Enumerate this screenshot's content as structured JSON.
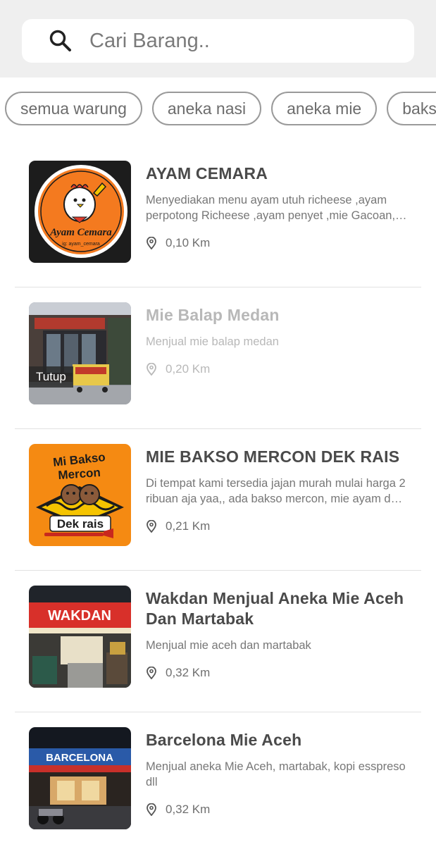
{
  "search": {
    "placeholder": "Cari Barang.."
  },
  "categories": [
    "semua warung",
    "aneka nasi",
    "aneka mie",
    "bakso"
  ],
  "stores": [
    {
      "name": "AYAM CEMARA",
      "description": "Menyediakan menu ayam utuh richeese ,ayam perpotong Richeese ,ayam penyet ,mie Gacoan, dll",
      "distance": "0,10 Km",
      "logo_text": "Ayam Cemara",
      "logo_subtext": "ig: ayam_cemara"
    },
    {
      "name": "Mie Balap Medan",
      "description": "Menjual mie balap medan",
      "distance": "0,20 Km",
      "status": "Tutup"
    },
    {
      "name": "MIE BAKSO MERCON DEK RAIS",
      "description": "Di tempat kami tersedia jajan murah mulai harga 2 ribuan aja yaa,, ada bakso mercon, mie ayam dan lainnya",
      "distance": "0,21 Km",
      "logo_text_top": "Mi Bakso",
      "logo_text_mid": "Mercon",
      "logo_text_bottom": "Dek rais"
    },
    {
      "name": "Wakdan Menjual Aneka Mie Aceh Dan Martabak",
      "description": "Menjual mie aceh dan martabak",
      "distance": "0,32 Km",
      "sign_text": "WAKDAN"
    },
    {
      "name": "Barcelona Mie Aceh",
      "description": "Menjual aneka Mie Aceh, martabak, kopi esspreso dll",
      "distance": "0,32 Km",
      "sign_text": "BARCELONA"
    }
  ]
}
